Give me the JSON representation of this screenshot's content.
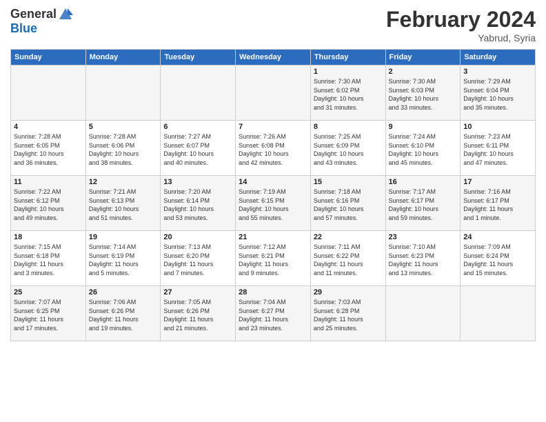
{
  "header": {
    "logo_line1": "General",
    "logo_line2": "Blue",
    "month": "February 2024",
    "location": "Yabrud, Syria"
  },
  "days_of_week": [
    "Sunday",
    "Monday",
    "Tuesday",
    "Wednesday",
    "Thursday",
    "Friday",
    "Saturday"
  ],
  "weeks": [
    [
      {
        "day": "",
        "info": ""
      },
      {
        "day": "",
        "info": ""
      },
      {
        "day": "",
        "info": ""
      },
      {
        "day": "",
        "info": ""
      },
      {
        "day": "1",
        "info": "Sunrise: 7:30 AM\nSunset: 6:02 PM\nDaylight: 10 hours\nand 31 minutes."
      },
      {
        "day": "2",
        "info": "Sunrise: 7:30 AM\nSunset: 6:03 PM\nDaylight: 10 hours\nand 33 minutes."
      },
      {
        "day": "3",
        "info": "Sunrise: 7:29 AM\nSunset: 6:04 PM\nDaylight: 10 hours\nand 35 minutes."
      }
    ],
    [
      {
        "day": "4",
        "info": "Sunrise: 7:28 AM\nSunset: 6:05 PM\nDaylight: 10 hours\nand 36 minutes."
      },
      {
        "day": "5",
        "info": "Sunrise: 7:28 AM\nSunset: 6:06 PM\nDaylight: 10 hours\nand 38 minutes."
      },
      {
        "day": "6",
        "info": "Sunrise: 7:27 AM\nSunset: 6:07 PM\nDaylight: 10 hours\nand 40 minutes."
      },
      {
        "day": "7",
        "info": "Sunrise: 7:26 AM\nSunset: 6:08 PM\nDaylight: 10 hours\nand 42 minutes."
      },
      {
        "day": "8",
        "info": "Sunrise: 7:25 AM\nSunset: 6:09 PM\nDaylight: 10 hours\nand 43 minutes."
      },
      {
        "day": "9",
        "info": "Sunrise: 7:24 AM\nSunset: 6:10 PM\nDaylight: 10 hours\nand 45 minutes."
      },
      {
        "day": "10",
        "info": "Sunrise: 7:23 AM\nSunset: 6:11 PM\nDaylight: 10 hours\nand 47 minutes."
      }
    ],
    [
      {
        "day": "11",
        "info": "Sunrise: 7:22 AM\nSunset: 6:12 PM\nDaylight: 10 hours\nand 49 minutes."
      },
      {
        "day": "12",
        "info": "Sunrise: 7:21 AM\nSunset: 6:13 PM\nDaylight: 10 hours\nand 51 minutes."
      },
      {
        "day": "13",
        "info": "Sunrise: 7:20 AM\nSunset: 6:14 PM\nDaylight: 10 hours\nand 53 minutes."
      },
      {
        "day": "14",
        "info": "Sunrise: 7:19 AM\nSunset: 6:15 PM\nDaylight: 10 hours\nand 55 minutes."
      },
      {
        "day": "15",
        "info": "Sunrise: 7:18 AM\nSunset: 6:16 PM\nDaylight: 10 hours\nand 57 minutes."
      },
      {
        "day": "16",
        "info": "Sunrise: 7:17 AM\nSunset: 6:17 PM\nDaylight: 10 hours\nand 59 minutes."
      },
      {
        "day": "17",
        "info": "Sunrise: 7:16 AM\nSunset: 6:17 PM\nDaylight: 11 hours\nand 1 minute."
      }
    ],
    [
      {
        "day": "18",
        "info": "Sunrise: 7:15 AM\nSunset: 6:18 PM\nDaylight: 11 hours\nand 3 minutes."
      },
      {
        "day": "19",
        "info": "Sunrise: 7:14 AM\nSunset: 6:19 PM\nDaylight: 11 hours\nand 5 minutes."
      },
      {
        "day": "20",
        "info": "Sunrise: 7:13 AM\nSunset: 6:20 PM\nDaylight: 11 hours\nand 7 minutes."
      },
      {
        "day": "21",
        "info": "Sunrise: 7:12 AM\nSunset: 6:21 PM\nDaylight: 11 hours\nand 9 minutes."
      },
      {
        "day": "22",
        "info": "Sunrise: 7:11 AM\nSunset: 6:22 PM\nDaylight: 11 hours\nand 11 minutes."
      },
      {
        "day": "23",
        "info": "Sunrise: 7:10 AM\nSunset: 6:23 PM\nDaylight: 11 hours\nand 13 minutes."
      },
      {
        "day": "24",
        "info": "Sunrise: 7:09 AM\nSunset: 6:24 PM\nDaylight: 11 hours\nand 15 minutes."
      }
    ],
    [
      {
        "day": "25",
        "info": "Sunrise: 7:07 AM\nSunset: 6:25 PM\nDaylight: 11 hours\nand 17 minutes."
      },
      {
        "day": "26",
        "info": "Sunrise: 7:06 AM\nSunset: 6:26 PM\nDaylight: 11 hours\nand 19 minutes."
      },
      {
        "day": "27",
        "info": "Sunrise: 7:05 AM\nSunset: 6:26 PM\nDaylight: 11 hours\nand 21 minutes."
      },
      {
        "day": "28",
        "info": "Sunrise: 7:04 AM\nSunset: 6:27 PM\nDaylight: 11 hours\nand 23 minutes."
      },
      {
        "day": "29",
        "info": "Sunrise: 7:03 AM\nSunset: 6:28 PM\nDaylight: 11 hours\nand 25 minutes."
      },
      {
        "day": "",
        "info": ""
      },
      {
        "day": "",
        "info": ""
      }
    ]
  ]
}
